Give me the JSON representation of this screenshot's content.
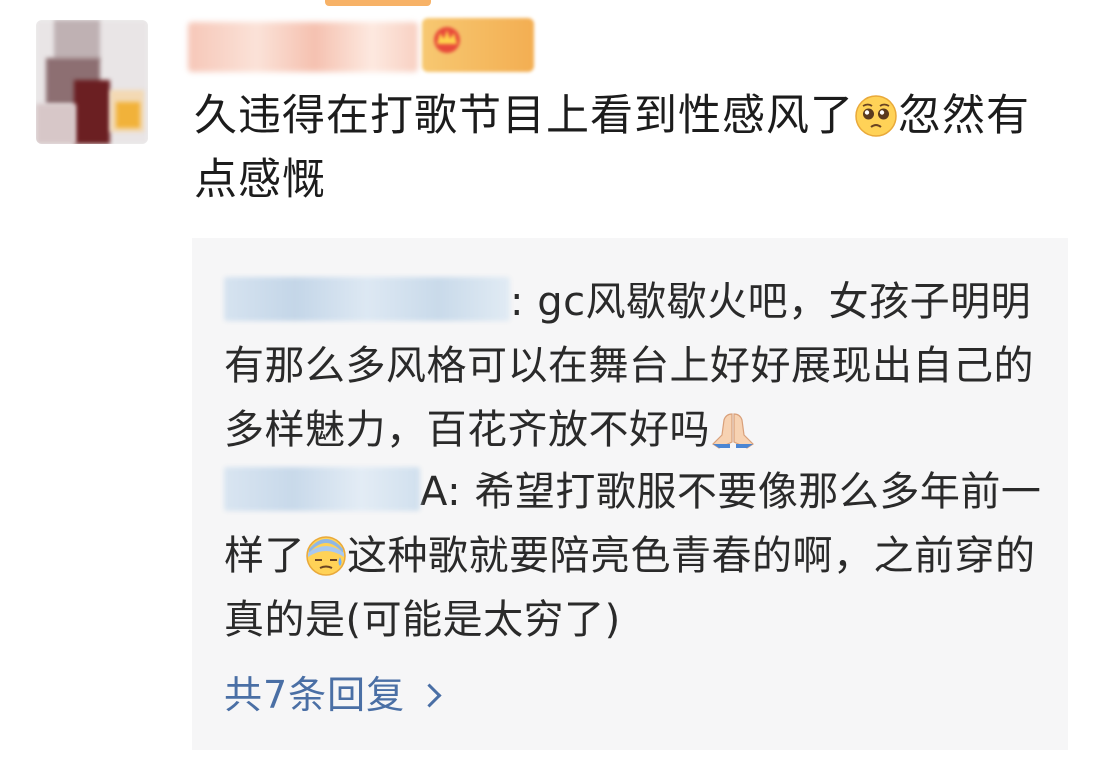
{
  "post": {
    "text_before_emoji": "久违得在打歌节目上看到性感风了",
    "emoji_1": "pleading-face",
    "text_after_emoji": "忽然有点感慨"
  },
  "replies": [
    {
      "name_suffix": ":",
      "text": " gc风歇歇火吧，女孩子明明有那么多风格可以在舞台上好好展现出自己的多样魅力，百花齐放不好吗",
      "trailing_emoji": "folded-hands"
    },
    {
      "name_suffix": "A:",
      "text_before_emoji": " 希望打歌服不要像那么多年前一样了",
      "emoji": "cold-sweat-face",
      "text_after_emoji": "这种歌就要陪亮色青春的啊，之前穿的真的是(可能是太穷了)"
    }
  ],
  "more_replies_label": "共7条回复",
  "colors": {
    "link": "#4a6fa5",
    "reply_background": "#f6f6f7",
    "vip_badge": "#f3ae52"
  }
}
